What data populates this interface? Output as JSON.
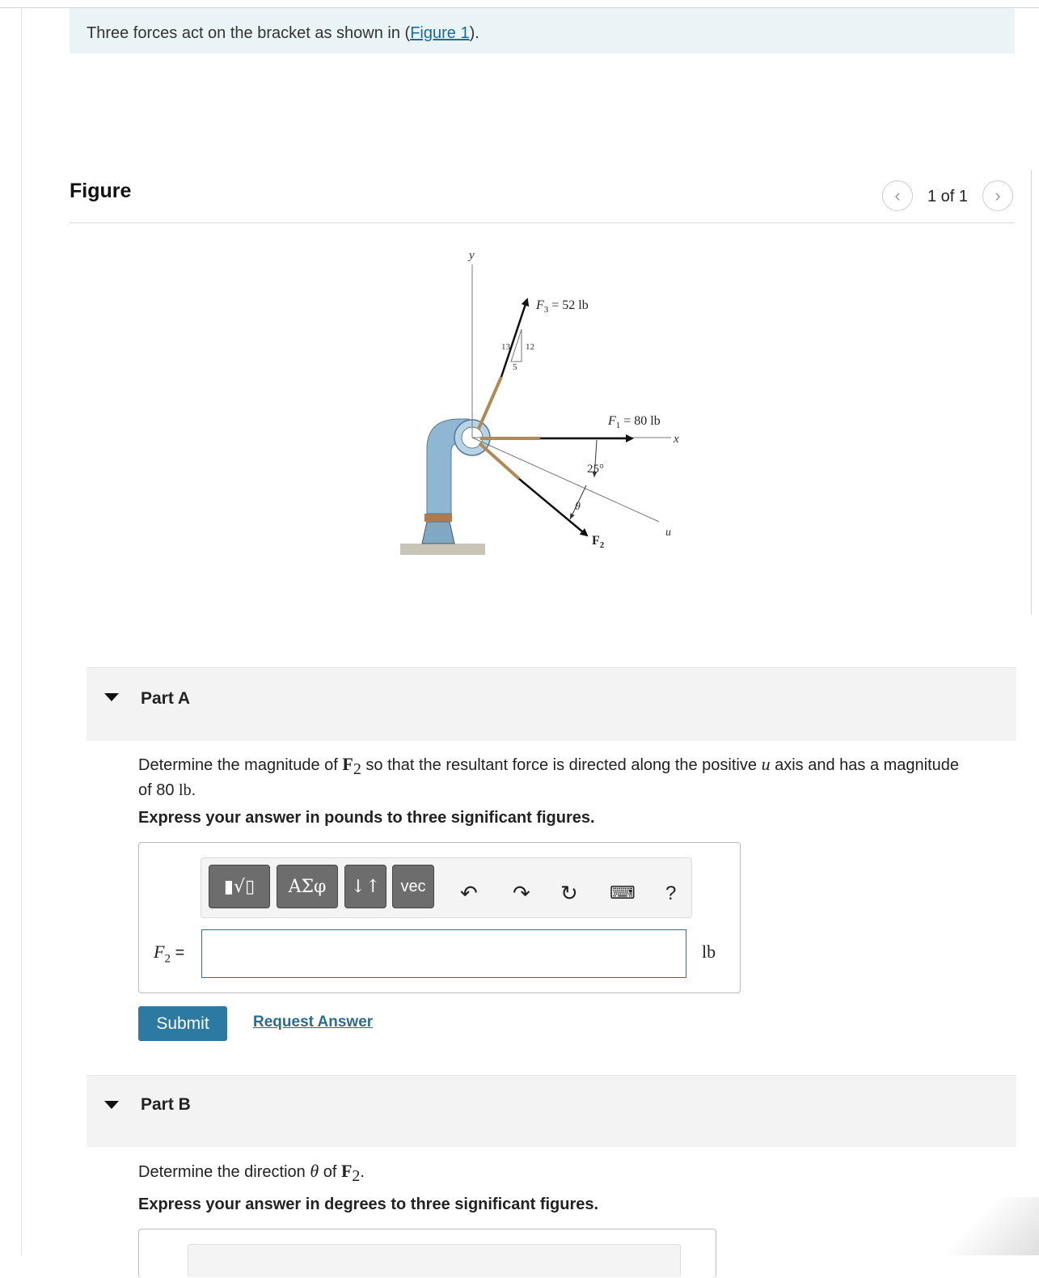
{
  "intro": {
    "text_before": "Three forces act on the bracket as shown in (",
    "link": "Figure 1",
    "text_after": ")."
  },
  "figure_panel": {
    "heading": "Figure",
    "pager_text": "1 of 1",
    "prev_icon": "chevron-left-icon",
    "next_icon": "chevron-right-icon"
  },
  "diagram": {
    "y_axis": "y",
    "x_axis": "x",
    "u_axis": "u",
    "f3_label": "F",
    "f3_sub": "3",
    "f3_value": " = 52 lb",
    "f1_label": "F",
    "f1_sub": "1",
    "f1_value": " = 80 lb",
    "f2_label": "F",
    "f2_sub": "2",
    "angle_25": "25°",
    "theta": "θ",
    "tri_13": "13",
    "tri_12": "12",
    "tri_5": "5"
  },
  "part_a": {
    "title": "Part A",
    "q1": "Determine the magnitude of ",
    "q_force": "F",
    "q_sub": "2",
    "q2": " so that the resultant force is directed along the positive ",
    "q_u": "u",
    "q3": " axis and has a magnitude",
    "q4_prefix": "of 80 ",
    "q4_unit": "lb",
    "q4_suffix": ".",
    "instruction": "Express your answer in pounds to three significant figures.",
    "toolbar": {
      "btn_templates": "▮√▯",
      "btn_greek": "ΑΣφ",
      "btn_arrows": "↓↑",
      "btn_vec": "vec",
      "undo_icon": "undo-icon",
      "redo_icon": "redo-icon",
      "reset_icon": "reset-icon",
      "keyboard_icon": "keyboard-icon",
      "help": "?"
    },
    "var_label": "F",
    "var_sub": "2",
    "var_eq": " =",
    "input_value": "",
    "unit": "lb",
    "submit": "Submit",
    "request": "Request Answer"
  },
  "part_b": {
    "title": "Part B",
    "q1": "Determine the direction ",
    "q_theta": "θ",
    "q2": " of ",
    "q_force": "F",
    "q_sub": "2",
    "q3": ".",
    "instruction": "Express your answer in degrees to three significant figures."
  }
}
